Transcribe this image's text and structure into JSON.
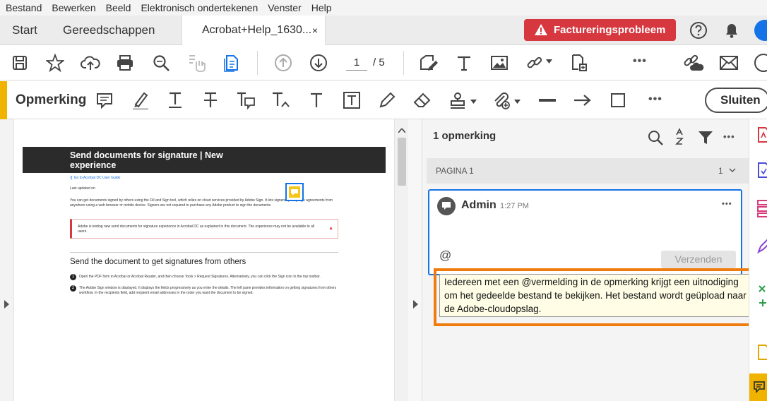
{
  "menu": [
    "Bestand",
    "Bewerken",
    "Beeld",
    "Elektronisch ondertekenen",
    "Venster",
    "Help"
  ],
  "tabs": {
    "start": "Start",
    "tools": "Gereedschappen",
    "document": "Acrobat+Help_1630...",
    "close": "×"
  },
  "billing_label": "Factureringsprobleem",
  "toolbar": {
    "page_current": "1",
    "page_total": "/ 5",
    "more": "•••"
  },
  "comment_toolbar": {
    "title": "Opmerking",
    "more": "•••",
    "close": "Sluiten"
  },
  "panel": {
    "count": "1 opmerking",
    "page_label": "PAGINA 1",
    "page_count": "1",
    "comment": {
      "author": "Admin",
      "time": "1:27 PM",
      "more": "•••",
      "at": "@",
      "send": "Verzenden"
    },
    "tooltip": "Iedereen met een @vermelding in de opmerking krijgt een uitnodiging om het gedeelde bestand te bekijken. Het bestand wordt geüpload naar de Adobe-cloudopslag."
  },
  "pdf": {
    "title": "Send documents for signature | New experience",
    "back_link": "❮ Go to Acrobat DC User Guide",
    "updated": "Last updated on",
    "intro": "You can get documents signed by others using the Fill and Sign tool, which relies on cloud services provided by Adobe Sign. It lets signers quickly sign agreements from anywhere using a web browser or mobile device. Signers are not required to purchase any Adobe product to sign the documents.",
    "note": "Adobe is testing new send documents for signature experience in Acrobat DC as explained in this document. The experience may not be available to all users.",
    "heading": "Send the document to get signatures from others",
    "step1": "Open the PDF form in Acrobat or Acrobat Reader, and then choose Tools > Request Signatures. Alternatively, you can click the Sign icon in the top toolbar.",
    "step2": "The Adobe Sign window is displayed. It displays the fields progressively as you enter the details. The left pane provides information on getting signatures from others workflow. In the recipients field, add recipient email addresses in the order you want the document to be signed."
  },
  "colors": {
    "accent": "#f0b400",
    "billing": "#d7373f",
    "highlight": "#f07c0d",
    "focus": "#1473e6"
  }
}
